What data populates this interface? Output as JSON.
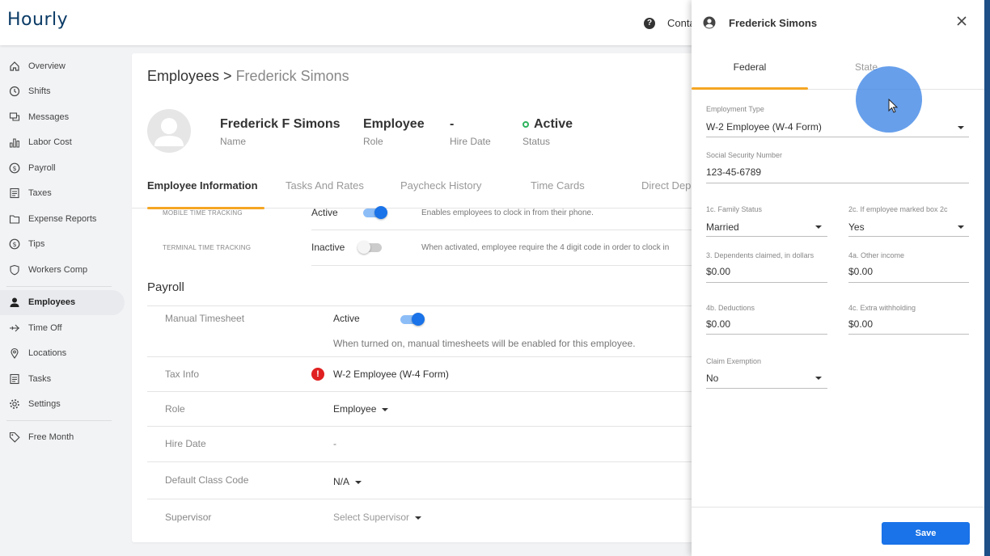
{
  "app": {
    "logo": "Hourly",
    "help_label": "?",
    "contact_label": "Conta"
  },
  "sidebar": {
    "items": [
      {
        "label": "Overview",
        "icon": "home-icon"
      },
      {
        "label": "Shifts",
        "icon": "clock-icon"
      },
      {
        "label": "Messages",
        "icon": "chat-icon"
      },
      {
        "label": "Labor Cost",
        "icon": "bar-chart-icon"
      },
      {
        "label": "Payroll",
        "icon": "dollar-circle-icon"
      },
      {
        "label": "Taxes",
        "icon": "document-icon"
      },
      {
        "label": "Expense Reports",
        "icon": "folder-icon"
      },
      {
        "label": "Tips",
        "icon": "dollar-circle-icon"
      },
      {
        "label": "Workers Comp",
        "icon": "shield-icon"
      },
      {
        "label": "Employees",
        "icon": "person-icon",
        "active": true
      },
      {
        "label": "Time Off",
        "icon": "plane-icon"
      },
      {
        "label": "Locations",
        "icon": "location-pin-icon"
      },
      {
        "label": "Tasks",
        "icon": "document-icon"
      },
      {
        "label": "Settings",
        "icon": "gear-icon"
      },
      {
        "label": "Free Month",
        "icon": "tag-icon"
      }
    ]
  },
  "main": {
    "breadcrumb": {
      "parent": "Employees",
      "separator": " > ",
      "current": "Frederick Simons"
    },
    "header": {
      "name": "Frederick F Simons",
      "name_label": "Name",
      "role": "Employee",
      "role_label": "Role",
      "hire_date": "-",
      "hire_date_label": "Hire Date",
      "status": "Active",
      "status_label": "Status"
    },
    "tabs": [
      "Employee Information",
      "Tasks And Rates",
      "Paycheck History",
      "Time Cards",
      "Direct Depo"
    ],
    "time_tracking": [
      {
        "label": "MOBILE TIME TRACKING",
        "value": "Active",
        "on": true,
        "description": "Enables employees to clock in from their phone."
      },
      {
        "label": "TERMINAL TIME TRACKING",
        "value": "Inactive",
        "on": false,
        "description": "When activated, employee require the 4 digit code in order to clock in"
      }
    ],
    "payroll": {
      "title": "Payroll",
      "manual_timesheet": {
        "label": "Manual Timesheet",
        "value": "Active",
        "on": true,
        "description": "When turned on, manual timesheets will be enabled for this employee."
      },
      "tax_info": {
        "label": "Tax Info",
        "value": "W-2 Employee (W-4 Form)",
        "warning": "!"
      },
      "role": {
        "label": "Role",
        "value": "Employee"
      },
      "hire_date": {
        "label": "Hire Date",
        "value": "-"
      },
      "default_class_code": {
        "label": "Default Class Code",
        "value": "N/A"
      },
      "supervisor": {
        "label": "Supervisor",
        "value": "Select Supervisor"
      }
    }
  },
  "panel": {
    "title": "Frederick Simons",
    "tabs": [
      "Federal",
      "State"
    ],
    "active_tab": "Federal",
    "fields": {
      "employment_type": {
        "label": "Employment Type",
        "value": "W-2 Employee (W-4 Form)"
      },
      "ssn": {
        "label": "Social Security Number",
        "value": "123-45-6789"
      },
      "family_status": {
        "label": "1c. Family Status",
        "value": "Married"
      },
      "box_2c": {
        "label": "2c. If employee marked box 2c",
        "value": "Yes"
      },
      "dependents": {
        "label": "3. Dependents claimed, in dollars",
        "value": "$0.00"
      },
      "other_income": {
        "label": "4a. Other income",
        "value": "$0.00"
      },
      "deductions": {
        "label": "4b. Deductions",
        "value": "$0.00"
      },
      "extra_withholding": {
        "label": "4c. Extra withholding",
        "value": "$0.00"
      },
      "claim_exemption": {
        "label": "Claim Exemption",
        "value": "No"
      }
    },
    "save_label": "Save"
  },
  "colors": {
    "accent": "#1a73e8",
    "tab_underline": "#f5a623",
    "logo": "#0b3b66",
    "status_active": "#2db35d",
    "warning": "#e02020"
  }
}
